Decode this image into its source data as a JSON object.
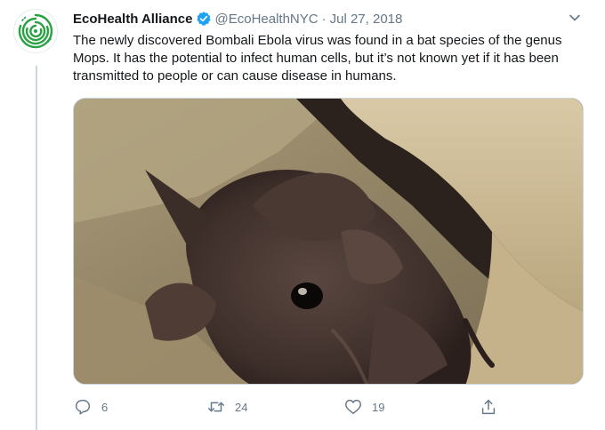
{
  "tweet": {
    "author_name": "EcoHealth Alliance",
    "handle": "@EcoHealthNYC",
    "separator": "·",
    "date": "Jul 27, 2018",
    "text": "The newly discovered Bombali Ebola virus was found in a bat species of the genus Mops. It has the potential to infect human cells, but it’s not known yet if it has been transmitted to people or can cause disease in humans.",
    "verified": true,
    "media_description_icon": "bat-photo",
    "actions": {
      "reply_count": "6",
      "retweet_count": "24",
      "like_count": "19"
    }
  },
  "colors": {
    "brand_green": "#2aa243",
    "verified_blue": "#1da1f2",
    "muted": "#657786",
    "text": "#14171a"
  },
  "icons": [
    "avatar-logo",
    "verified-badge-icon",
    "chevron-down-icon",
    "reply-icon",
    "retweet-icon",
    "like-icon",
    "share-icon"
  ]
}
